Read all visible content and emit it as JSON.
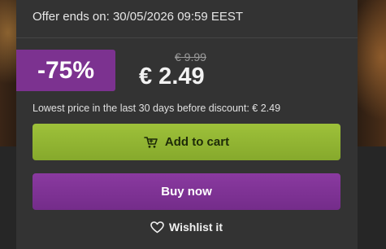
{
  "offer": {
    "ends_label": "Offer ends on: 30/05/2026 09:59 EEST"
  },
  "pricing": {
    "discount": "-75%",
    "old_price": "€ 9.99",
    "new_price": "€ 2.49",
    "lowest_note": "Lowest price in the last 30 days before discount: € 2.49"
  },
  "actions": {
    "add_to_cart": "Add to cart",
    "buy_now": "Buy now",
    "wishlist": "Wishlist it"
  },
  "icons": {
    "cart": "cart-icon",
    "wishlist": "heart-icon"
  },
  "colors": {
    "discount_bg": "#7c3290",
    "cart_button": "#9ec13a",
    "buy_button": "#8a3aa0",
    "panel_bg": "#333333"
  }
}
